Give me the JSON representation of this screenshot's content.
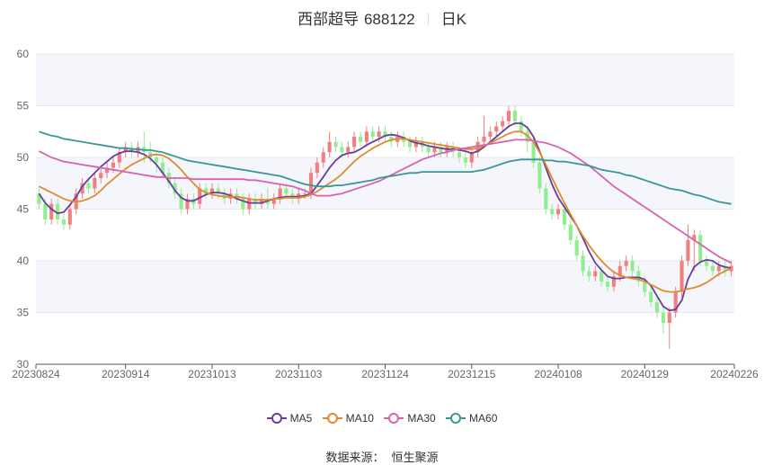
{
  "title": {
    "name": "西部超导",
    "code": "688122",
    "period": "日K"
  },
  "source": {
    "label": "数据来源：",
    "value": "恒生聚源"
  },
  "colors": {
    "up": "#f08080",
    "down": "#90ee90",
    "ma5": "#6a3d9a",
    "ma10": "#e08a2f",
    "ma30": "#d962b0",
    "ma60": "#3a9696",
    "band": "#f4f6fb",
    "grid": "#e6e8ee"
  },
  "chart_data": {
    "type": "candlestick",
    "ylim": [
      30,
      60
    ],
    "yticks": [
      30,
      35,
      40,
      45,
      50,
      55,
      60
    ],
    "xtick_labels": [
      {
        "index": 0,
        "label": "20230824"
      },
      {
        "index": 14,
        "label": "20230914"
      },
      {
        "index": 28,
        "label": "20231013"
      },
      {
        "index": 42,
        "label": "20231103"
      },
      {
        "index": 56,
        "label": "20231124"
      },
      {
        "index": 70,
        "label": "20231215"
      },
      {
        "index": 84,
        "label": "20240108"
      },
      {
        "index": 98,
        "label": "20240129"
      },
      {
        "index": 112,
        "label": "20240226"
      }
    ],
    "candles": [
      [
        46.5,
        45.5,
        47.0,
        45.0
      ],
      [
        45.5,
        44.0,
        46.0,
        43.5
      ],
      [
        44.0,
        45.5,
        46.0,
        43.5
      ],
      [
        45.5,
        44.0,
        46.0,
        43.5
      ],
      [
        44.0,
        43.5,
        44.5,
        43.0
      ],
      [
        43.5,
        45.0,
        45.5,
        43.0
      ],
      [
        45.0,
        46.5,
        47.0,
        44.5
      ],
      [
        46.5,
        47.5,
        48.0,
        46.0
      ],
      [
        47.5,
        47.0,
        48.0,
        46.5
      ],
      [
        47.0,
        48.0,
        48.5,
        46.5
      ],
      [
        48.0,
        48.5,
        49.0,
        47.5
      ],
      [
        48.5,
        49.0,
        49.5,
        48.0
      ],
      [
        49.0,
        49.5,
        50.0,
        48.5
      ],
      [
        49.5,
        50.5,
        51.0,
        49.0
      ],
      [
        50.5,
        51.0,
        51.5,
        50.0
      ],
      [
        51.0,
        50.5,
        51.5,
        50.0
      ],
      [
        50.5,
        51.0,
        51.5,
        50.0
      ],
      [
        51.0,
        50.5,
        52.5,
        49.5
      ],
      [
        50.5,
        50.0,
        51.5,
        49.5
      ],
      [
        50.0,
        49.5,
        50.5,
        48.5
      ],
      [
        49.5,
        48.5,
        50.0,
        48.0
      ],
      [
        48.5,
        47.5,
        49.0,
        47.0
      ],
      [
        47.5,
        46.5,
        48.0,
        46.0
      ],
      [
        46.5,
        45.0,
        47.0,
        44.5
      ],
      [
        45.0,
        46.0,
        46.5,
        44.5
      ],
      [
        46.0,
        45.5,
        46.5,
        45.0
      ],
      [
        45.5,
        47.0,
        47.5,
        45.0
      ],
      [
        47.0,
        46.5,
        47.5,
        46.0
      ],
      [
        46.5,
        47.0,
        47.5,
        46.0
      ],
      [
        47.0,
        46.5,
        47.5,
        46.0
      ],
      [
        46.5,
        46.0,
        47.0,
        45.5
      ],
      [
        46.0,
        46.5,
        47.0,
        45.5
      ],
      [
        46.5,
        46.0,
        47.0,
        45.5
      ],
      [
        46.0,
        45.0,
        46.5,
        44.5
      ],
      [
        45.0,
        46.0,
        46.5,
        44.5
      ],
      [
        46.0,
        45.5,
        46.5,
        45.0
      ],
      [
        45.5,
        46.0,
        46.5,
        45.0
      ],
      [
        46.0,
        45.5,
        47.0,
        45.0
      ],
      [
        45.5,
        46.0,
        46.5,
        45.0
      ],
      [
        46.0,
        47.0,
        47.5,
        45.5
      ],
      [
        47.0,
        46.5,
        47.5,
        46.0
      ],
      [
        46.5,
        46.0,
        47.0,
        45.5
      ],
      [
        46.0,
        46.5,
        47.0,
        45.5
      ],
      [
        46.5,
        46.5,
        47.0,
        46.0
      ],
      [
        46.5,
        48.5,
        49.0,
        46.0
      ],
      [
        48.5,
        49.5,
        50.0,
        48.0
      ],
      [
        49.5,
        50.5,
        51.0,
        49.0
      ],
      [
        50.5,
        51.5,
        52.5,
        50.0
      ],
      [
        51.5,
        51.0,
        52.0,
        50.5
      ],
      [
        51.0,
        50.5,
        51.5,
        50.0
      ],
      [
        50.5,
        51.0,
        51.5,
        50.0
      ],
      [
        51.0,
        52.0,
        52.5,
        50.5
      ],
      [
        52.0,
        51.5,
        52.5,
        51.0
      ],
      [
        51.5,
        52.5,
        53.0,
        51.0
      ],
      [
        52.5,
        52.0,
        53.0,
        51.5
      ],
      [
        52.0,
        52.5,
        53.0,
        51.5
      ],
      [
        52.5,
        52.0,
        53.0,
        51.5
      ],
      [
        52.0,
        51.5,
        52.5,
        51.0
      ],
      [
        51.5,
        52.0,
        52.5,
        51.0
      ],
      [
        52.0,
        51.5,
        52.5,
        51.0
      ],
      [
        51.5,
        51.0,
        52.0,
        50.5
      ],
      [
        51.0,
        51.5,
        52.0,
        50.5
      ],
      [
        51.5,
        51.0,
        52.0,
        50.5
      ],
      [
        51.0,
        50.5,
        51.5,
        50.0
      ],
      [
        50.5,
        51.0,
        51.5,
        50.0
      ],
      [
        51.0,
        50.5,
        51.5,
        50.0
      ],
      [
        50.5,
        51.0,
        51.5,
        50.0
      ],
      [
        51.0,
        50.5,
        51.5,
        50.0
      ],
      [
        50.5,
        50.0,
        51.0,
        49.5
      ],
      [
        50.0,
        49.5,
        50.5,
        49.0
      ],
      [
        49.5,
        50.5,
        51.0,
        49.0
      ],
      [
        50.5,
        51.5,
        52.0,
        50.0
      ],
      [
        51.5,
        52.0,
        54.0,
        51.0
      ],
      [
        52.0,
        52.5,
        53.0,
        51.5
      ],
      [
        52.5,
        53.0,
        53.5,
        52.0
      ],
      [
        53.0,
        53.5,
        54.0,
        52.5
      ],
      [
        53.5,
        54.5,
        55.0,
        53.0
      ],
      [
        54.5,
        53.5,
        55.0,
        53.0
      ],
      [
        53.5,
        52.5,
        54.0,
        52.0
      ],
      [
        52.5,
        51.5,
        53.0,
        50.5
      ],
      [
        51.5,
        49.5,
        52.0,
        49.0
      ],
      [
        49.5,
        47.0,
        50.0,
        46.5
      ],
      [
        47.0,
        45.0,
        47.5,
        44.5
      ],
      [
        45.0,
        44.5,
        45.5,
        44.0
      ],
      [
        44.5,
        45.0,
        45.5,
        44.0
      ],
      [
        45.0,
        43.5,
        45.5,
        43.0
      ],
      [
        43.5,
        42.0,
        44.0,
        41.5
      ],
      [
        42.0,
        40.5,
        42.5,
        40.0
      ],
      [
        40.5,
        39.0,
        41.0,
        38.5
      ],
      [
        39.0,
        38.5,
        39.5,
        38.0
      ],
      [
        38.5,
        39.0,
        39.5,
        38.0
      ],
      [
        39.0,
        38.0,
        39.5,
        37.5
      ],
      [
        38.0,
        37.5,
        38.5,
        37.0
      ],
      [
        37.5,
        38.5,
        39.0,
        37.0
      ],
      [
        38.5,
        39.5,
        40.0,
        38.0
      ],
      [
        39.5,
        40.0,
        40.5,
        39.0
      ],
      [
        40.0,
        39.0,
        40.5,
        38.5
      ],
      [
        39.0,
        38.0,
        39.5,
        37.5
      ],
      [
        38.0,
        37.0,
        38.5,
        36.5
      ],
      [
        37.0,
        36.0,
        37.5,
        35.5
      ],
      [
        36.0,
        35.0,
        36.5,
        34.5
      ],
      [
        35.0,
        34.0,
        35.5,
        33.0
      ],
      [
        34.0,
        35.0,
        35.5,
        31.5
      ],
      [
        35.0,
        37.0,
        37.5,
        34.5
      ],
      [
        37.0,
        40.0,
        40.5,
        36.5
      ],
      [
        40.0,
        42.0,
        43.5,
        39.5
      ],
      [
        42.0,
        42.5,
        43.0,
        39.0
      ],
      [
        42.5,
        40.0,
        43.0,
        39.5
      ],
      [
        40.0,
        39.5,
        40.5,
        39.0
      ],
      [
        39.5,
        39.0,
        40.0,
        38.5
      ],
      [
        39.0,
        39.5,
        40.0,
        38.5
      ],
      [
        39.5,
        39.0,
        40.0,
        38.5
      ],
      [
        39.0,
        39.5,
        40.0,
        38.5
      ]
    ],
    "series": [
      {
        "name": "MA5",
        "color": "#6a3d9a",
        "values": [
          46.5,
          45.6,
          45.0,
          44.6,
          44.7,
          45.4,
          46.2,
          47.2,
          47.9,
          48.5,
          49.1,
          49.6,
          50.1,
          50.4,
          50.6,
          50.6,
          50.5,
          50.3,
          49.9,
          49.3,
          48.5,
          47.7,
          46.8,
          46.1,
          45.8,
          45.8,
          46.1,
          46.4,
          46.6,
          46.6,
          46.5,
          46.3,
          46.0,
          45.8,
          45.6,
          45.6,
          45.6,
          45.8,
          46.0,
          46.1,
          46.2,
          46.2,
          46.2,
          46.3,
          46.5,
          47.3,
          48.1,
          49.0,
          49.7,
          50.2,
          50.4,
          50.5,
          50.8,
          51.2,
          51.5,
          51.8,
          52.1,
          52.2,
          52.1,
          51.9,
          51.6,
          51.4,
          51.3,
          51.1,
          51.0,
          50.9,
          50.8,
          50.8,
          50.7,
          50.6,
          50.4,
          50.6,
          51.0,
          51.5,
          52.0,
          52.5,
          53.0,
          53.3,
          53.3,
          52.9,
          52.0,
          50.6,
          49.0,
          47.4,
          46.1,
          45.2,
          44.3,
          43.4,
          42.2,
          40.9,
          39.8,
          39.1,
          38.5,
          38.3,
          38.3,
          38.4,
          38.4,
          38.4,
          38.2,
          37.6,
          36.6,
          35.6,
          35.2,
          35.3,
          36.2,
          38.2,
          39.4,
          39.9,
          40.1,
          40.0,
          39.6,
          39.4,
          39.3
        ]
      },
      {
        "name": "MA10",
        "color": "#e08a2f",
        "values": [
          47.2,
          46.9,
          46.6,
          46.3,
          46.0,
          45.8,
          45.7,
          45.8,
          46.0,
          46.3,
          46.8,
          47.4,
          47.9,
          48.4,
          48.9,
          49.3,
          49.6,
          49.9,
          50.2,
          50.3,
          50.2,
          49.9,
          49.4,
          48.8,
          48.1,
          47.5,
          46.9,
          46.6,
          46.4,
          46.3,
          46.2,
          46.2,
          46.2,
          46.1,
          46.0,
          45.9,
          45.9,
          45.9,
          46.0,
          46.0,
          46.1,
          46.1,
          46.1,
          46.2,
          46.4,
          46.7,
          47.1,
          47.5,
          47.9,
          48.4,
          49.0,
          49.6,
          50.1,
          50.5,
          50.9,
          51.2,
          51.5,
          51.7,
          51.8,
          51.8,
          51.7,
          51.6,
          51.5,
          51.4,
          51.3,
          51.2,
          51.1,
          51.0,
          50.9,
          50.8,
          50.8,
          50.9,
          51.1,
          51.4,
          51.7,
          52.0,
          52.3,
          52.5,
          52.5,
          52.1,
          51.5,
          50.5,
          49.3,
          48.0,
          46.8,
          45.6,
          44.5,
          43.4,
          42.4,
          41.5,
          40.7,
          40.0,
          39.4,
          38.9,
          38.6,
          38.4,
          38.3,
          38.2,
          38.0,
          37.7,
          37.4,
          37.1,
          37.0,
          37.0,
          37.1,
          37.3,
          37.4,
          37.6,
          37.9,
          38.3,
          38.7,
          39.0,
          39.3
        ]
      },
      {
        "name": "MA30",
        "color": "#d962b0",
        "values": [
          50.6,
          50.3,
          50.0,
          49.8,
          49.6,
          49.5,
          49.4,
          49.3,
          49.2,
          49.1,
          49.0,
          48.9,
          48.8,
          48.7,
          48.6,
          48.5,
          48.4,
          48.3,
          48.2,
          48.1,
          48.1,
          48.0,
          48.0,
          48.0,
          48.0,
          47.9,
          47.9,
          47.9,
          47.9,
          47.9,
          47.9,
          47.9,
          47.9,
          47.9,
          47.8,
          47.8,
          47.7,
          47.6,
          47.5,
          47.4,
          47.3,
          47.2,
          47.0,
          46.8,
          46.5,
          46.3,
          46.3,
          46.3,
          46.4,
          46.5,
          46.7,
          46.9,
          47.1,
          47.3,
          47.5,
          47.7,
          48.0,
          48.3,
          48.6,
          48.9,
          49.2,
          49.5,
          49.8,
          50.0,
          50.2,
          50.4,
          50.5,
          50.7,
          50.8,
          50.9,
          51.0,
          51.1,
          51.2,
          51.3,
          51.4,
          51.5,
          51.6,
          51.7,
          51.7,
          51.7,
          51.6,
          51.5,
          51.4,
          51.2,
          51.0,
          50.7,
          50.4,
          50.0,
          49.6,
          49.2,
          48.7,
          48.2,
          47.7,
          47.2,
          46.8,
          46.4,
          46.0,
          45.6,
          45.2,
          44.8,
          44.4,
          44.0,
          43.6,
          43.2,
          42.8,
          42.4,
          42.0,
          41.6,
          41.2,
          40.8,
          40.4,
          40.1,
          39.8
        ]
      },
      {
        "name": "MA60",
        "color": "#3a9696",
        "values": [
          52.5,
          52.3,
          52.1,
          52.0,
          51.8,
          51.7,
          51.6,
          51.5,
          51.4,
          51.3,
          51.2,
          51.1,
          51.0,
          50.9,
          50.9,
          50.8,
          50.8,
          50.7,
          50.7,
          50.6,
          50.5,
          50.3,
          50.1,
          49.9,
          49.7,
          49.6,
          49.5,
          49.4,
          49.3,
          49.2,
          49.1,
          49.0,
          48.9,
          48.8,
          48.7,
          48.6,
          48.5,
          48.4,
          48.3,
          48.2,
          48.0,
          47.8,
          47.6,
          47.4,
          47.3,
          47.2,
          47.2,
          47.2,
          47.3,
          47.3,
          47.4,
          47.5,
          47.6,
          47.7,
          47.8,
          48.0,
          48.1,
          48.2,
          48.3,
          48.4,
          48.5,
          48.5,
          48.6,
          48.6,
          48.6,
          48.6,
          48.6,
          48.6,
          48.6,
          48.6,
          48.6,
          48.7,
          48.8,
          49.0,
          49.2,
          49.4,
          49.6,
          49.7,
          49.8,
          49.8,
          49.8,
          49.8,
          49.7,
          49.7,
          49.6,
          49.6,
          49.5,
          49.4,
          49.3,
          49.2,
          49.0,
          48.8,
          48.7,
          48.6,
          48.5,
          48.3,
          48.2,
          48.0,
          47.8,
          47.6,
          47.4,
          47.2,
          47.0,
          46.9,
          46.8,
          46.6,
          46.4,
          46.3,
          46.1,
          45.9,
          45.7,
          45.6,
          45.5
        ]
      }
    ]
  }
}
